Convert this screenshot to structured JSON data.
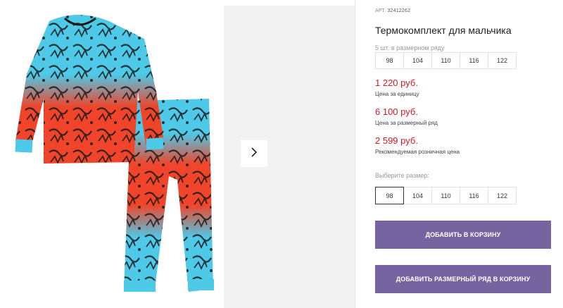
{
  "gallery": {
    "next_icon": "chevron-right-icon",
    "product_image": "kids-thermal-set-graffiti-print"
  },
  "product": {
    "art_label": "АРТ.",
    "art_number": "32412262",
    "title": "Термокомплект для мальчика",
    "series_caption": "5 шт. в размерном ряду",
    "series_sizes": [
      "98",
      "104",
      "110",
      "116",
      "122"
    ],
    "prices": [
      {
        "value": "1 220 руб.",
        "label": "Цена за единицу"
      },
      {
        "value": "6 100 руб.",
        "label": "Цена за размерный ряд"
      },
      {
        "value": "2 599 руб.",
        "label": "Рекомендуемая розничная цена"
      }
    ],
    "choose_size_label": "Выберите размер:",
    "size_options": [
      "98",
      "104",
      "110",
      "116",
      "122"
    ],
    "selected_size": "98"
  },
  "actions": {
    "add_to_cart": "ДОБАВИТЬ В КОРЗИНУ",
    "add_series_to_cart": "ДОБАВИТЬ РАЗМЕРНЫЙ РЯД В КОРЗИНУ"
  },
  "colors": {
    "price": "#d11a2a",
    "button": "#7664a1",
    "garment_blue": "#4ec9e8",
    "garment_red": "#f0452a"
  }
}
